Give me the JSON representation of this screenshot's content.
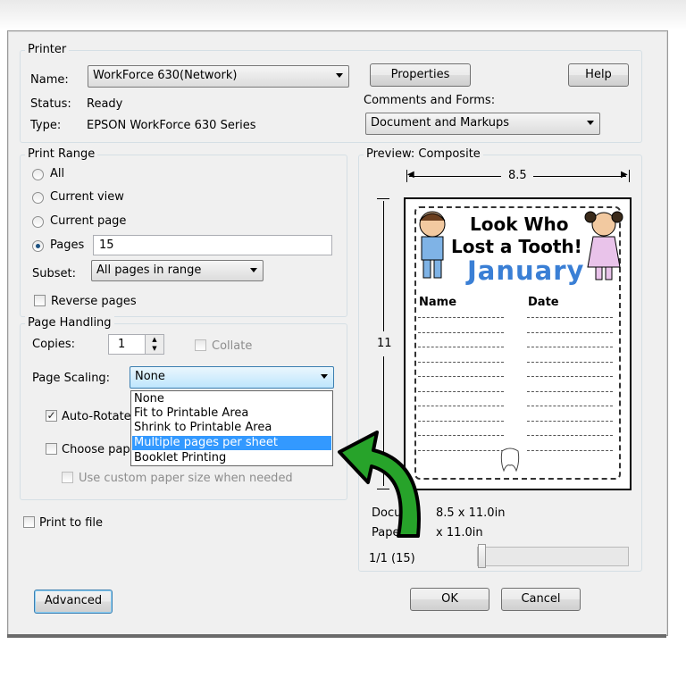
{
  "printer": {
    "group_label": "Printer",
    "name_label": "Name:",
    "name_value": "WorkForce 630(Network)",
    "status_label": "Status:",
    "status_value": "Ready",
    "type_label": "Type:",
    "type_value": "EPSON WorkForce 630 Series",
    "properties_button": "Properties",
    "help_button": "Help",
    "comments_label": "Comments and Forms:",
    "comments_value": "Document and Markups"
  },
  "print_range": {
    "group_label": "Print Range",
    "all": "All",
    "current_view": "Current view",
    "current_page": "Current page",
    "pages": "Pages",
    "pages_value": "15",
    "subset_label": "Subset:",
    "subset_value": "All pages in range",
    "reverse_pages": "Reverse pages"
  },
  "page_handling": {
    "group_label": "Page Handling",
    "copies_label": "Copies:",
    "copies_value": "1",
    "collate": "Collate",
    "scaling_label": "Page Scaling:",
    "scaling_value": "None",
    "auto_rotate": "Auto-Rotate",
    "choose_paper": "Choose pape",
    "custom_paper": "Use custom paper size when needed",
    "options": [
      "None",
      "Fit to Printable Area",
      "Shrink to Printable Area",
      "Multiple pages per sheet",
      "Booklet Printing"
    ],
    "selected_option": "Multiple pages per sheet"
  },
  "print_to_file": "Print to file",
  "preview": {
    "group_label": "Preview: Composite",
    "width_label": "8.5",
    "height_label": "11",
    "document_label": "Docum",
    "document_size": "8.5 x 11.0in",
    "paper_label": "Pape",
    "paper_size": "x 11.0in",
    "page_counter": "1/1 (15)",
    "worksheet": {
      "title_line1": "Look Who",
      "title_line2": "Lost a Tooth!",
      "month": "January",
      "col_name": "Name",
      "col_date": "Date"
    }
  },
  "buttons": {
    "advanced": "Advanced",
    "ok": "OK",
    "cancel": "Cancel"
  },
  "colors": {
    "arrow_green": "#27a32a",
    "selection_blue": "#3399ff",
    "month_blue": "#3a7fd5"
  }
}
